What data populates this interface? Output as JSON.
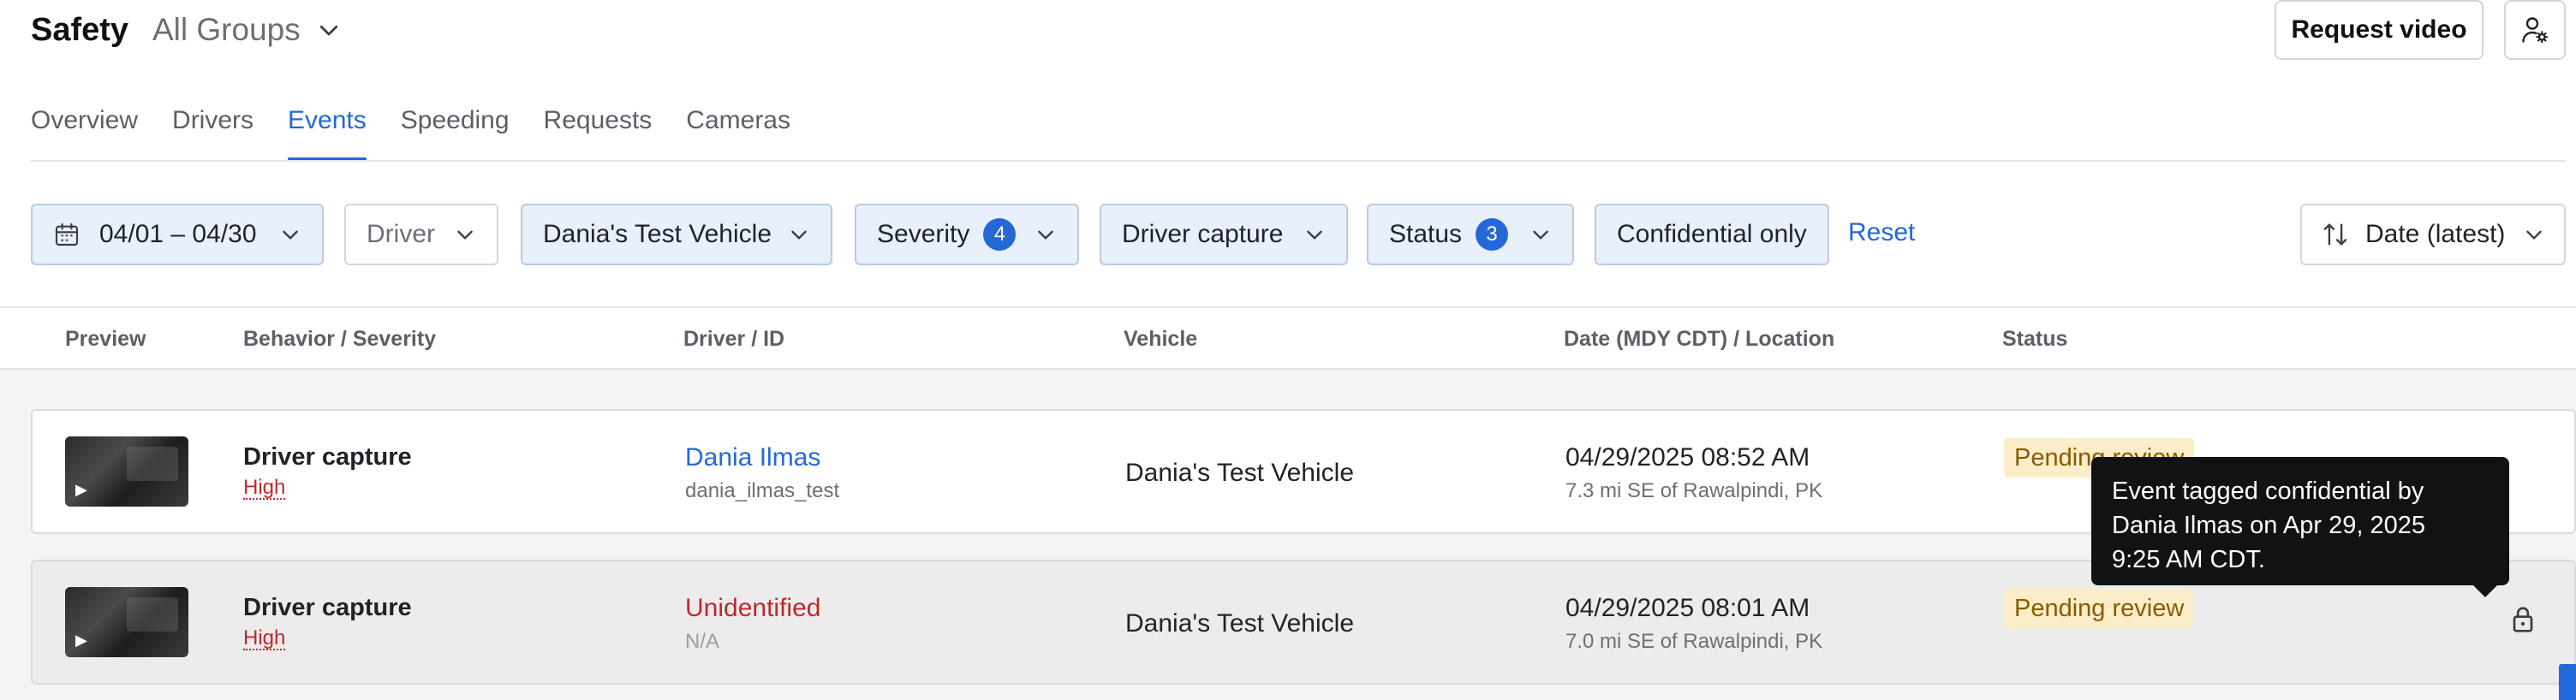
{
  "header": {
    "app_title": "Safety",
    "group_select": "All Groups",
    "request_video_label": "Request video",
    "user_settings_icon": "user-settings-icon"
  },
  "tabs": [
    {
      "label": "Overview",
      "active": false
    },
    {
      "label": "Drivers",
      "active": false
    },
    {
      "label": "Events",
      "active": true
    },
    {
      "label": "Speeding",
      "active": false
    },
    {
      "label": "Requests",
      "active": false
    },
    {
      "label": "Cameras",
      "active": false
    }
  ],
  "filters": {
    "date_range": "04/01 – 04/30",
    "driver": "Driver",
    "vehicle": "Dania's Test Vehicle",
    "severity": {
      "label": "Severity",
      "count": "4"
    },
    "behavior": "Driver capture",
    "status": {
      "label": "Status",
      "count": "3"
    },
    "confidential": "Confidential only",
    "reset": "Reset",
    "sort": "Date (latest)"
  },
  "table": {
    "columns": [
      "Preview",
      "Behavior / Severity",
      "Driver / ID",
      "Vehicle",
      "Date (MDY CDT) / Location",
      "Status"
    ],
    "rows": [
      {
        "behavior": "Driver capture",
        "severity": "High",
        "driver": "Dania Ilmas",
        "driver_id": "dania_ilmas_test",
        "vehicle": "Dania's Test Vehicle",
        "date": "04/29/2025 08:52 AM",
        "location": "7.3 mi SE of Rawalpindi, PK",
        "status": "Pending review"
      },
      {
        "behavior": "Driver capture",
        "severity": "High",
        "driver": "Unidentified",
        "driver_id": "N/A",
        "vehicle": "Dania's Test Vehicle",
        "date": "04/29/2025 08:01 AM",
        "location": "7.0 mi SE of Rawalpindi, PK",
        "status": "Pending review"
      }
    ]
  },
  "tooltip": {
    "line1": "Event tagged confidential by",
    "line2": "Dania Ilmas on Apr 29, 2025",
    "line3": "9:25 AM CDT."
  },
  "colors": {
    "accent": "#2468d8",
    "severity_high": "#c0282d",
    "pending_bg": "#fbedc8",
    "pending_text": "#8a5a00",
    "filter_active_bg": "#e8f0fb"
  }
}
